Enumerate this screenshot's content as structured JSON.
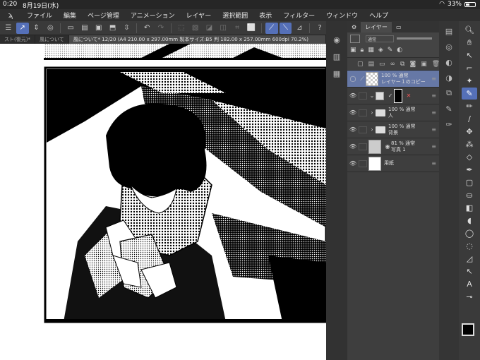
{
  "status": {
    "time": "0:20",
    "date": "8月19日(水)",
    "battery": "33%"
  },
  "menu": [
    "ファイル",
    "編集",
    "ページ管理",
    "アニメーション",
    "レイヤー",
    "選択範囲",
    "表示",
    "フィルター",
    "ウィンドウ",
    "ヘルプ"
  ],
  "tabs": {
    "left": "スト(復元)*",
    "second": "風について",
    "active": "風について* 12/20 (A4 210.00 x 297.00mm 製本サイズ:B5 判 182.00 x 257.00mm 600dpi 70.2%)"
  },
  "layer_panel": {
    "tab_label": "レイヤー",
    "blend_mode": "通常",
    "layers": [
      {
        "opacity": "100 %",
        "mode": "通常",
        "name": "レイヤー１のコピー",
        "selected": true,
        "kind": "raster"
      },
      {
        "opacity": "",
        "mode": "",
        "name": "",
        "selected": false,
        "kind": "mask"
      },
      {
        "opacity": "100 %",
        "mode": "通常",
        "name": "人",
        "selected": false,
        "kind": "folder"
      },
      {
        "opacity": "100 %",
        "mode": "通常",
        "name": "背景",
        "selected": false,
        "kind": "folder"
      },
      {
        "opacity": "81 %",
        "mode": "通常",
        "name": "写真 1",
        "selected": false,
        "kind": "photo"
      },
      {
        "opacity": "",
        "mode": "",
        "name": "用紙",
        "selected": false,
        "kind": "paper"
      }
    ]
  },
  "colors": {
    "accent": "#5570b8",
    "selected_layer": "#6678a6",
    "main_color": "#000000",
    "sub_color": "#ffffff"
  }
}
